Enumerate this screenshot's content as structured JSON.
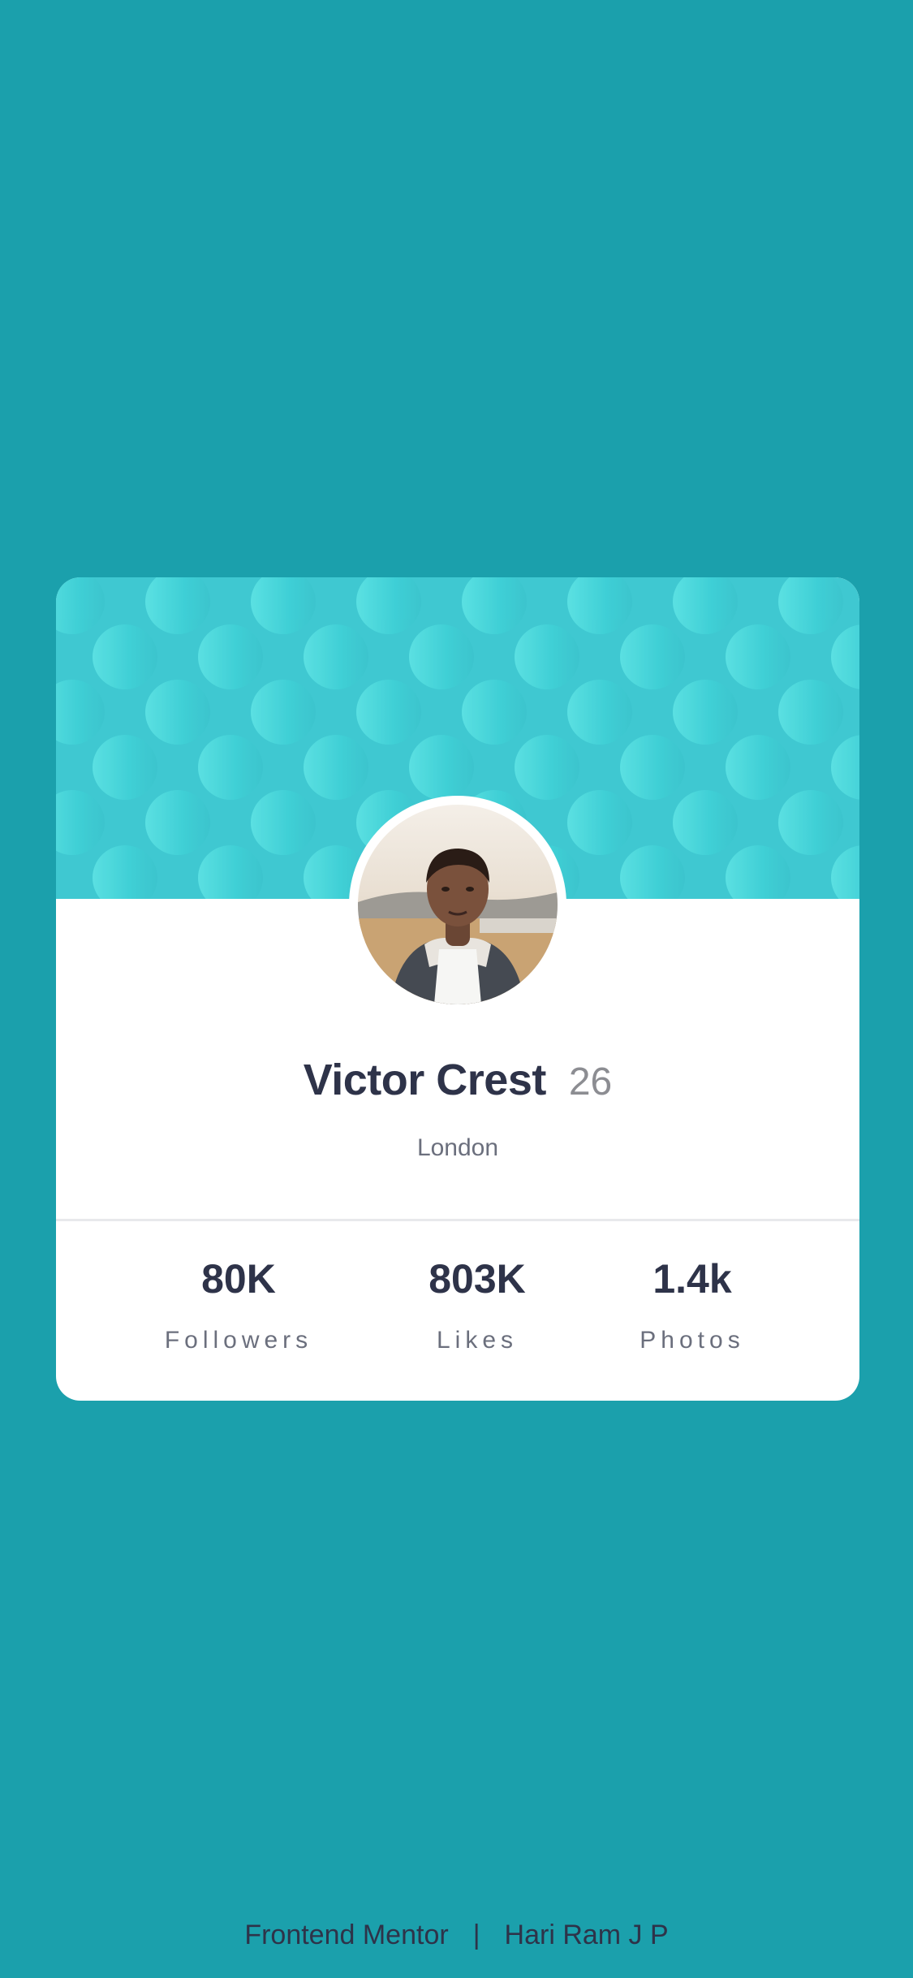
{
  "profile": {
    "name": "Victor Crest",
    "age": "26",
    "location": "London",
    "avatar_icon": "person-photo"
  },
  "stats": [
    {
      "value": "80K",
      "label": "Followers"
    },
    {
      "value": "803K",
      "label": "Likes"
    },
    {
      "value": "1.4k",
      "label": "Photos"
    }
  ],
  "footer": {
    "left": "Frontend Mentor",
    "separator": "|",
    "right": "Hari Ram J P"
  },
  "colors": {
    "background": "#1ba0ac",
    "header": "#3fc8d1",
    "card": "#ffffff",
    "primary_text": "#2e3349",
    "muted_text": "#6b6f7d"
  }
}
